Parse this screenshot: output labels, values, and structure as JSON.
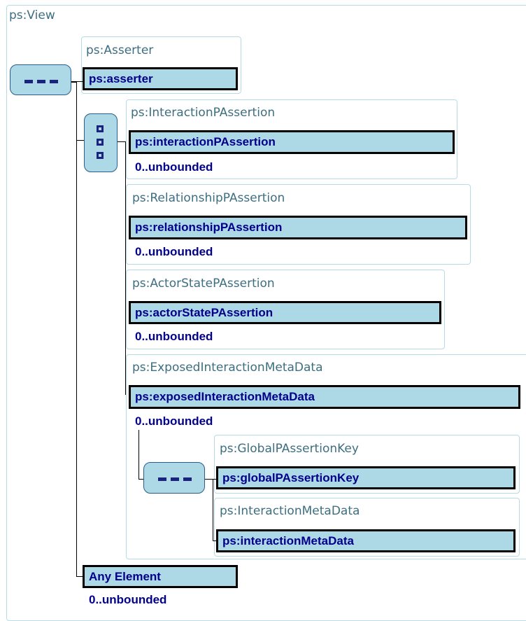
{
  "root": {
    "title": "ps:View"
  },
  "compositors": {
    "root_sequence": "sequence-icon",
    "choice": "choice-icon",
    "nested_sequence": "sequence-icon"
  },
  "asserter": {
    "type_label": "ps:Asserter",
    "element": "ps:asserter"
  },
  "interaction": {
    "type_label": "ps:InteractionPAssertion",
    "element": "ps:interactionPAssertion",
    "occurs": "0..unbounded"
  },
  "relationship": {
    "type_label": "ps:RelationshipPAssertion",
    "element": "ps:relationshipPAssertion",
    "occurs": "0..unbounded"
  },
  "actor_state": {
    "type_label": "ps:ActorStatePAssertion",
    "element": "ps:actorStatePAssertion",
    "occurs": "0..unbounded"
  },
  "exposed": {
    "type_label": "ps:ExposedInteractionMetaData",
    "element": "ps:exposedInteractionMetaData",
    "occurs": "0..unbounded"
  },
  "global_key": {
    "type_label": "ps:GlobalPAssertionKey",
    "element": "ps:globalPAssertionKey"
  },
  "interaction_meta": {
    "type_label": "ps:InteractionMetaData",
    "element": "ps:interactionMetaData"
  },
  "any": {
    "element": "Any Element",
    "occurs": "0..unbounded"
  },
  "colors": {
    "element_fill": "#add8e6",
    "element_text": "#00008b",
    "frame_border": "#b7dbe7",
    "frame_title": "#3d6f80"
  }
}
